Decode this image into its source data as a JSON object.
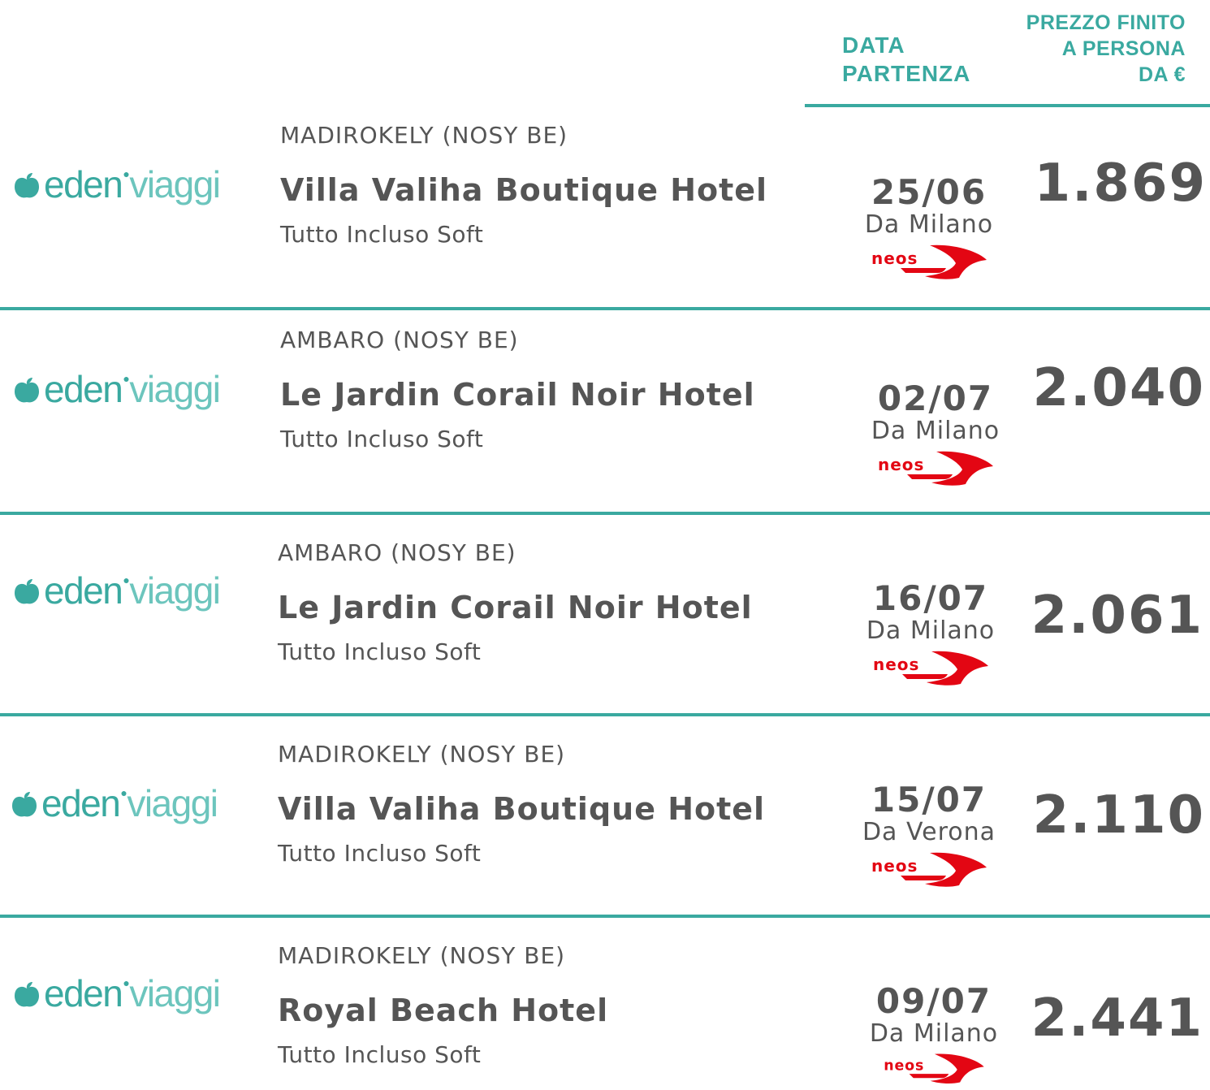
{
  "header": {
    "date_line1": "DATA",
    "date_line2": "PARTENZA",
    "price_line1": "PREZZO FINITO",
    "price_line2": "A PERSONA",
    "price_line3": "DA €"
  },
  "brand": {
    "name_part1": "eden",
    "name_part2": "viaggi",
    "color_primary": "#3aa9a0",
    "color_secondary": "#6cc5bd"
  },
  "airline": {
    "name": "neos",
    "color": "#e30613",
    "icon": "neos-logo-icon"
  },
  "offers": [
    {
      "location": "MADIROKELY (NOSY BE)",
      "hotel": "Villa Valiha Boutique Hotel",
      "board": "Tutto Incluso Soft",
      "date": "25/06",
      "departure": "Da Milano",
      "price": "1.869"
    },
    {
      "location": "AMBARO (NOSY BE)",
      "hotel": "Le Jardin Corail Noir Hotel",
      "board": "Tutto Incluso Soft",
      "date": "02/07",
      "departure": "Da Milano",
      "price": "2.040"
    },
    {
      "location": "AMBARO (NOSY BE)",
      "hotel": "Le Jardin Corail Noir Hotel",
      "board": "Tutto Incluso Soft",
      "date": "16/07",
      "departure": "Da Milano",
      "price": "2.061"
    },
    {
      "location": "MADIROKELY (NOSY BE)",
      "hotel": "Villa Valiha Boutique Hotel",
      "board": "Tutto Incluso Soft",
      "date": "15/07",
      "departure": "Da Verona",
      "price": "2.110"
    },
    {
      "location": "MADIROKELY (NOSY BE)",
      "hotel": "Royal Beach Hotel",
      "board": "Tutto Incluso Soft",
      "date": "09/07",
      "departure": "Da Milano",
      "price": "2.441"
    }
  ]
}
